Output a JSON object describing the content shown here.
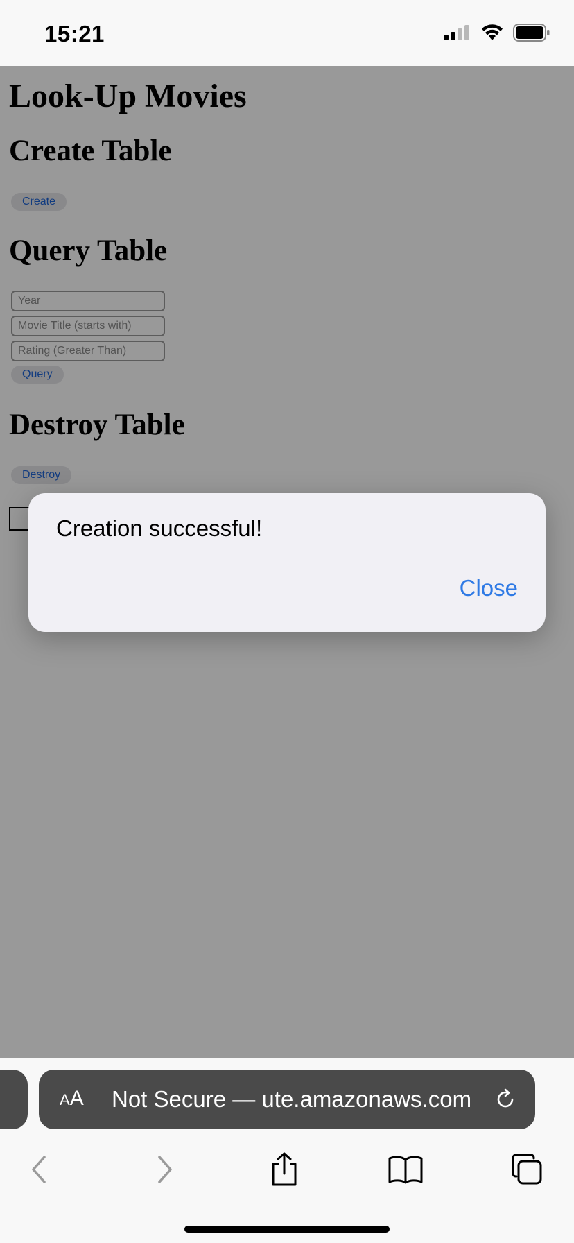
{
  "status_bar": {
    "time": "15:21"
  },
  "page": {
    "title": "Look-Up Movies",
    "create_section": {
      "heading": "Create Table",
      "button_label": "Create"
    },
    "query_section": {
      "heading": "Query Table",
      "year_placeholder": "Year",
      "title_placeholder": "Movie Title (starts with)",
      "rating_placeholder": "Rating (Greater Than)",
      "button_label": "Query"
    },
    "destroy_section": {
      "heading": "Destroy Table",
      "button_label": "Destroy"
    }
  },
  "alert": {
    "message": "Creation successful!",
    "close_label": "Close"
  },
  "toolbar": {
    "text_size_label_small": "A",
    "text_size_label_large": "A",
    "url_text": "Not Secure — ute.amazonaws.com"
  },
  "icons": {
    "signal": "cellular-signal-icon",
    "wifi": "wifi-icon",
    "battery": "battery-icon",
    "reload": "reload-icon",
    "back": "chevron-left-icon",
    "forward": "chevron-right-icon",
    "share": "share-icon",
    "bookmarks": "book-icon",
    "tabs": "tabs-icon"
  },
  "colors": {
    "link_blue": "#2f7ae5",
    "button_text": "#1f64d6",
    "overlay": "rgba(0,0,0,0.4)"
  }
}
